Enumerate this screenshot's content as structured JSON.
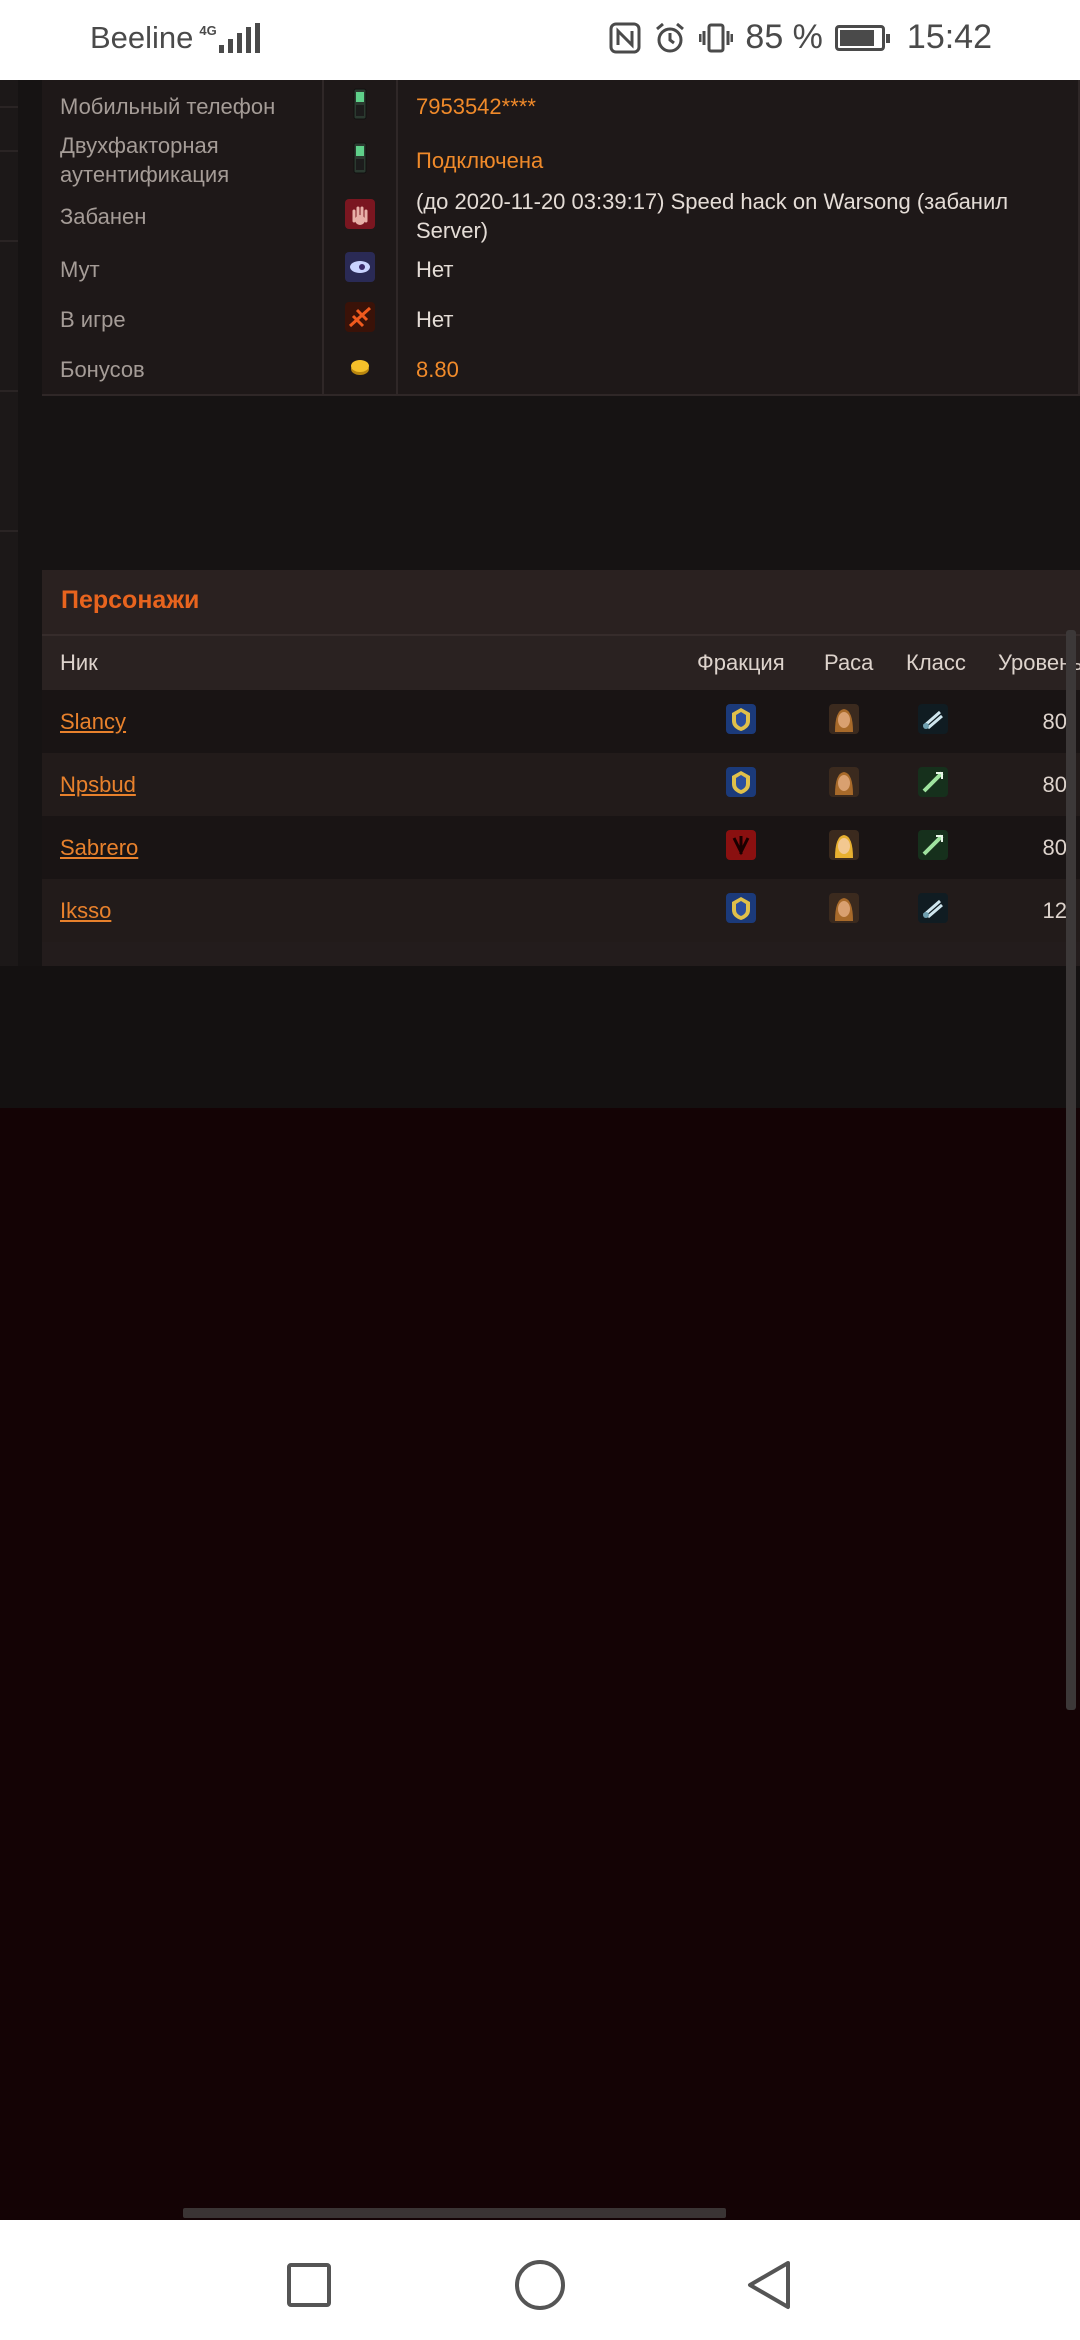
{
  "status_bar": {
    "carrier": "Beeline",
    "network": "4G",
    "battery_percent": "85 %",
    "battery_level": 0.85,
    "time": "15:42"
  },
  "account_info": [
    {
      "label": "Мобильный телефон",
      "icon": "mobile-phone-icon",
      "value": "7953542****",
      "style": "orange"
    },
    {
      "label": "Двухфакторная аутентификация",
      "icon": "mobile-phone-icon",
      "value": "Подключена",
      "style": "orange"
    },
    {
      "label": "Забанен",
      "icon": "ban-hand-icon",
      "value": "(до 2020-11-20 03:39:17) Speed hack on Warsong (забанил Server)",
      "style": "plain"
    },
    {
      "label": "Мут",
      "icon": "mute-icon",
      "value": "Нет",
      "style": "plain"
    },
    {
      "label": "В игре",
      "icon": "in-game-icon",
      "value": "Нет",
      "style": "plain"
    },
    {
      "label": "Бонусов",
      "icon": "coin-icon",
      "value": "8.80",
      "style": "orange"
    }
  ],
  "characters": {
    "title": "Персонажи",
    "headers": {
      "nick": "Ник",
      "faction": "Фракция",
      "race": "Раса",
      "class": "Класс",
      "level": "Уровень"
    },
    "rows": [
      {
        "nick": "Slancy",
        "faction": "alliance",
        "race": "human-female",
        "class": "rogue",
        "level": "80"
      },
      {
        "nick": "Npsbud",
        "faction": "alliance",
        "race": "human-female",
        "class": "hunter",
        "level": "80"
      },
      {
        "nick": "Sabrero",
        "faction": "horde",
        "race": "blood-elf-female",
        "class": "hunter",
        "level": "80"
      },
      {
        "nick": "Iksso",
        "faction": "alliance",
        "race": "human-female",
        "class": "rogue",
        "level": "12"
      }
    ]
  },
  "colors": {
    "accent_orange": "#f08a2a",
    "title_orange": "#e8641e",
    "background": "#140305"
  },
  "nav": {
    "recent": "square-nav-icon",
    "home": "circle-nav-icon",
    "back": "triangle-back-icon"
  }
}
